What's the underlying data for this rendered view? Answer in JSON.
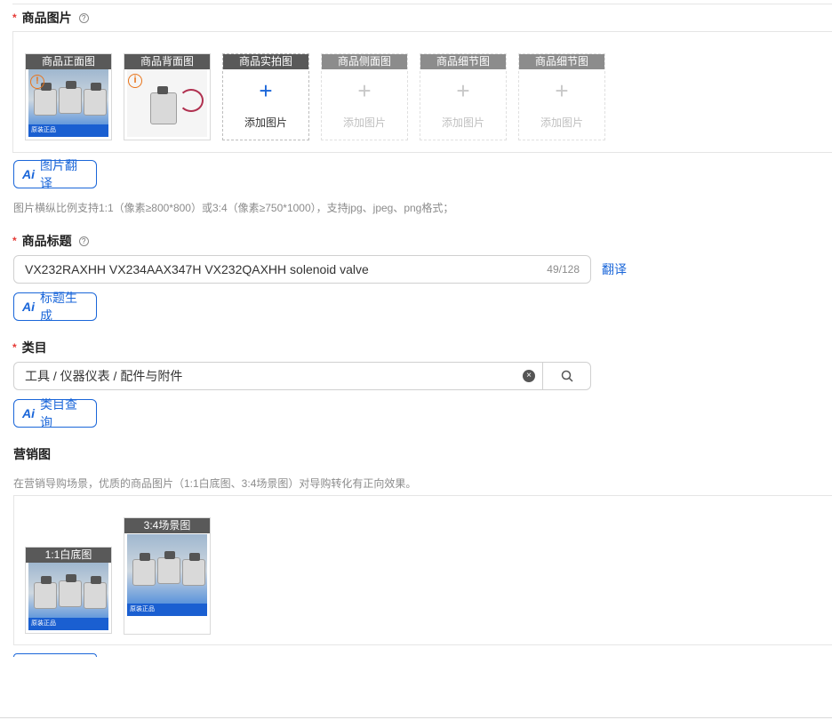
{
  "product_images": {
    "label": "商品图片",
    "slots": [
      {
        "title": "商品正面图",
        "state": "filled"
      },
      {
        "title": "商品背面图",
        "state": "filled"
      },
      {
        "title": "商品实拍图",
        "state": "add",
        "add_label": "添加图片"
      },
      {
        "title": "商品侧面图",
        "state": "disabled",
        "add_label": "添加图片"
      },
      {
        "title": "商品细节图",
        "state": "disabled",
        "add_label": "添加图片"
      },
      {
        "title": "商品细节图",
        "state": "disabled",
        "add_label": "添加图片"
      }
    ],
    "photo_band_text": "原装正品",
    "translate_button": "图片翻译",
    "hint": "图片横纵比例支持1:1（像素≥800*800）或3:4（像素≥750*1000），支持jpg、jpeg、png格式；"
  },
  "title": {
    "label": "商品标题",
    "value": "VX232RAXHH VX234AAX347H VX232QAXHH solenoid valve",
    "counter": "49/128",
    "translate_link": "翻译",
    "generate_button": "标题生成"
  },
  "category": {
    "label": "类目",
    "value": "工具 / 仪器仪表 / 配件与附件",
    "query_button": "类目查询"
  },
  "marketing": {
    "label": "营销图",
    "hint": "在营销导购场景，优质的商品图片（1:1白底图、3:4场景图）对导购转化有正向效果。",
    "slots": [
      {
        "title": "1:1白底图"
      },
      {
        "title": "3:4场景图"
      }
    ]
  },
  "ai_mark": "Ai",
  "colors": {
    "accent": "#1a66d9",
    "required": "#e53935",
    "warning": "#e8741a"
  }
}
